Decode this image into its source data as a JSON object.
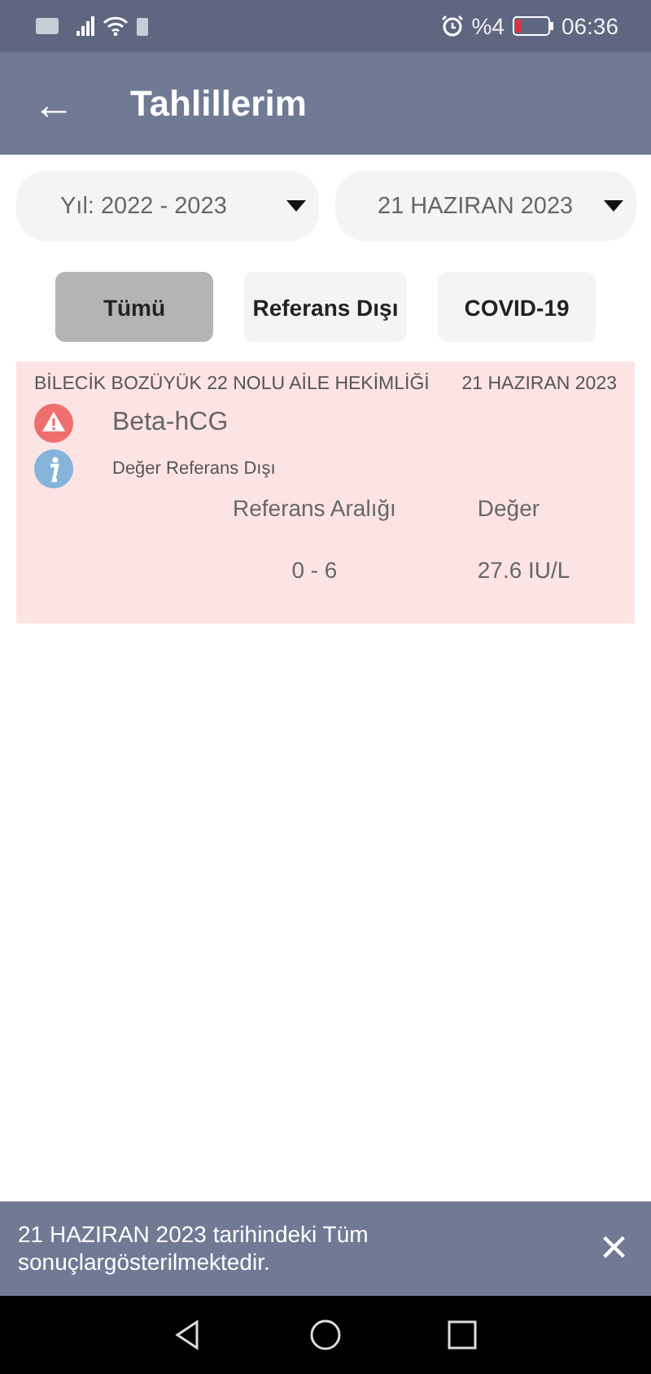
{
  "status_bar": {
    "battery_text": "%4",
    "time": "06:36"
  },
  "app_bar": {
    "back": "←",
    "title": "Tahlillerim"
  },
  "dropdowns": [
    {
      "value": "Yıl: 2022 - 2023"
    },
    {
      "value": "21 HAZIRAN 2023"
    }
  ],
  "filters": [
    {
      "label": "Tümü",
      "selected": true
    },
    {
      "label": "Referans Dışı",
      "selected": false
    },
    {
      "label": "COVID-19",
      "selected": false
    }
  ],
  "results": [
    {
      "institution": "BİLECİK BOZÜYÜK 22 NOLU AİLE HEKİMLİĞİ",
      "date": "21 HAZIRAN 2023",
      "test": "Beta-hCG",
      "note": "Değer Referans Dışı",
      "out_of_range": true,
      "range_label": "Referans Aralığı",
      "value_label": "Değer",
      "range": "0 - 6",
      "value": "27.6 IU/L"
    }
  ],
  "snackbar": {
    "message": "21 HAZIRAN 2023 tarihindeki Tüm sonuçlargösterilmektedir.",
    "close": "×"
  }
}
